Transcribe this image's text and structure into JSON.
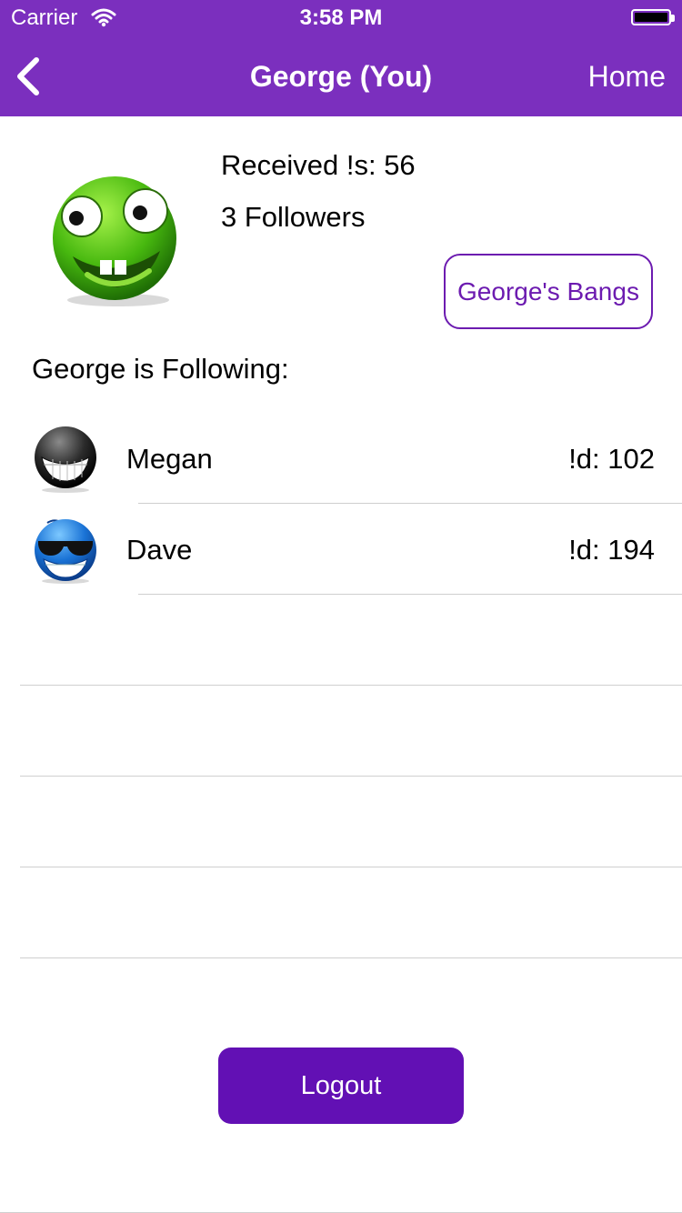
{
  "status_bar": {
    "carrier": "Carrier",
    "time": "3:58 PM"
  },
  "navbar": {
    "title": "George (You)",
    "home_label": "Home",
    "back_icon": "chevron-left-icon"
  },
  "profile": {
    "received": "Received !s: 56",
    "followers": "3 Followers",
    "bangs_button": "George's Bangs"
  },
  "following": {
    "title": "George is Following:",
    "items": [
      {
        "name": "Megan",
        "score": "!d: 102",
        "avatar": "grinning-black-smiley-icon"
      },
      {
        "name": "Dave",
        "score": "!d: 194",
        "avatar": "blue-sunglasses-smiley-icon"
      }
    ]
  },
  "logout_label": "Logout",
  "colors": {
    "header": "#7b2fbe",
    "accent": "#6c1bb0",
    "button": "#6210b4"
  }
}
